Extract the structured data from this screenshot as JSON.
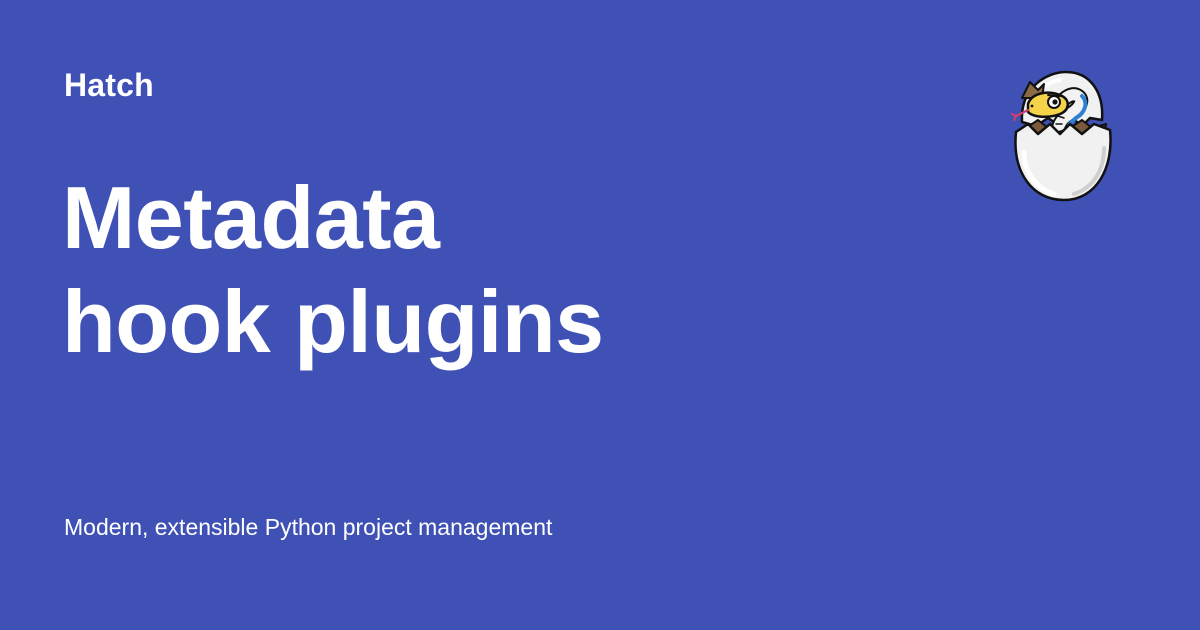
{
  "site": {
    "name": "Hatch"
  },
  "title": {
    "line1": "Metadata",
    "line2": "hook plugins"
  },
  "tagline": "Modern, extensible Python project management",
  "logo": {
    "icon": "hatching-snake-egg-icon"
  },
  "colors": {
    "background": "#3f51b5",
    "text": "#ffffff",
    "egg": "#f1f1f1",
    "snake_body": "#f6d44a",
    "snake_stripe": "#2f7fd4",
    "outline": "#111111"
  }
}
